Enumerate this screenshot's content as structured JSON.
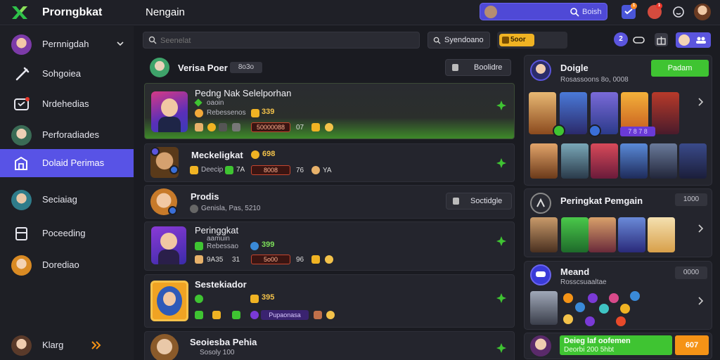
{
  "app": {
    "title": "Prorngbkat",
    "heading": "Nengain"
  },
  "topbar": {
    "search_label": "Boish",
    "notif_count_1": "1",
    "notif_count_2": "1"
  },
  "sidebar": {
    "items": [
      {
        "label": "Pernnigdah",
        "icon": "avatar-icon"
      },
      {
        "label": "Sohgoiea",
        "icon": "wrench-icon"
      },
      {
        "label": "Nrdehedias",
        "icon": "chat-icon"
      },
      {
        "label": "Perforadiades",
        "icon": "avatar-icon"
      },
      {
        "label": "Dolaid Perimas",
        "icon": "shop-icon"
      },
      {
        "label": "Seciaiag",
        "icon": "avatar-icon"
      },
      {
        "label": "Poceeding",
        "icon": "box-icon"
      },
      {
        "label": "Dorediao",
        "icon": "avatar-icon"
      }
    ],
    "footer_label": "Klarg"
  },
  "toolbar": {
    "search_placeholder": "Seenelat",
    "search_button": "Syendoano",
    "coins_value": "5oor",
    "icon_badge": "2"
  },
  "feed": {
    "header_name": "Verisa Poer",
    "header_tag": "8o3o",
    "header_button": "Boolidre",
    "cards": [
      {
        "title": "Pedng Nak Selelporhan",
        "line1": "oaoin",
        "line2": "Rebessenos",
        "value": "339",
        "bar": "50000088",
        "num": "07"
      },
      {
        "title": "Meckeligkat",
        "value": "698",
        "line2": "Deecip",
        "num2": "7A",
        "bar": "8008",
        "num": "76",
        "num3": "YA"
      },
      {
        "title": "Prodis",
        "line2": "Genisla, Pas, 5210",
        "button": "Soctidgle"
      },
      {
        "title": "Peringgkat",
        "line1": "aamuin",
        "line2": "Rebessao",
        "value": "399",
        "small": "9A35",
        "small2": "31",
        "bar": "5o00",
        "num": "96"
      },
      {
        "title": "Sestekiador",
        "value": "395",
        "badge": "Pupaonasa"
      },
      {
        "title": "Seoiesba Pehia",
        "line2": "Sosoly 100"
      }
    ]
  },
  "right": {
    "profile_name": "Doigle",
    "profile_sub": "Rosassoons 8o, 0008",
    "profile_button": "Padam",
    "featured_badge": "7 8 7 8",
    "ranking_title": "Peringkat Pemgain",
    "ranking_tag": "1000",
    "menu_title": "Meand",
    "menu_sub": "Rosscsuaaltae",
    "menu_tag": "0000",
    "promo_line1": "Deieg laf oofemen",
    "promo_line2": "Deorbi 200 5hbt",
    "promo_button": "607"
  },
  "colors": {
    "accent": "#5853e6",
    "green": "#3fc432",
    "orange": "#f59316",
    "gold": "#f0b323",
    "background": "#1b1c22"
  }
}
